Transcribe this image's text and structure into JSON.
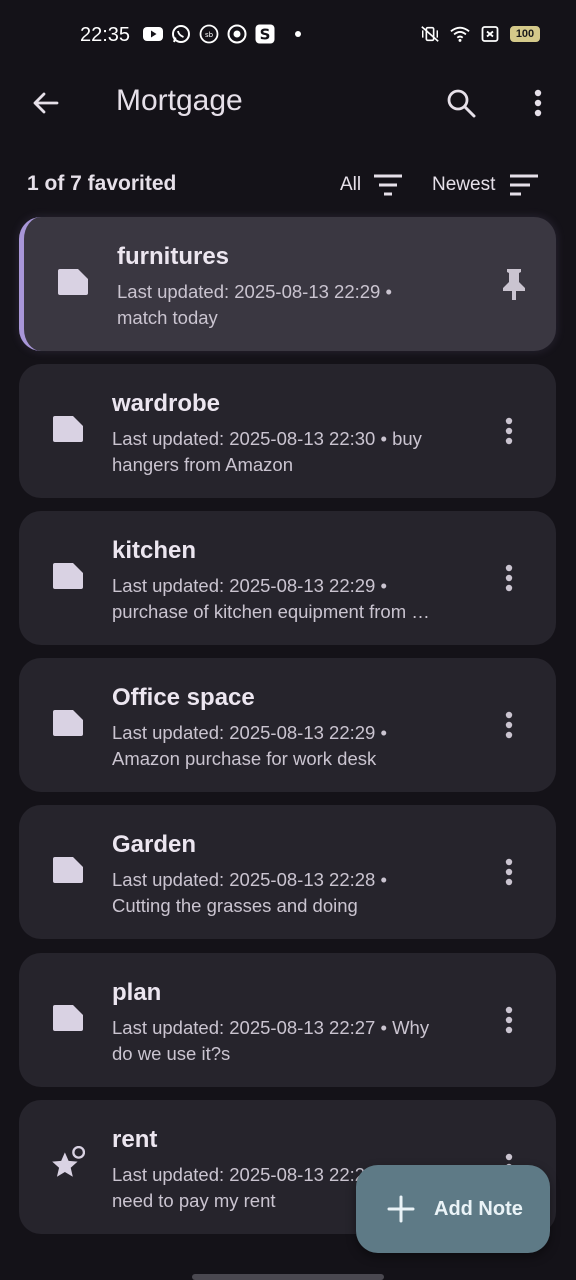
{
  "status_bar": {
    "time": "22:35",
    "left_icons": [
      "youtube-icon",
      "whatsapp-icon",
      "sb-app-icon",
      "chrome-icon",
      "s-app-icon"
    ],
    "right_icons": [
      "vibrate-icon",
      "wifi-icon",
      "sim-off-icon"
    ],
    "battery": "100",
    "battery_color": "#d4c98a"
  },
  "app_bar": {
    "title": "Mortgage"
  },
  "filters": {
    "favorited_text": "1 of 7 favorited",
    "filter_label": "All",
    "sort_label": "Newest"
  },
  "notes": [
    {
      "title": "furnitures",
      "line1": "Last updated: 2025-08-13 22:29 •",
      "line2": "match today",
      "pinned": true,
      "icon": "note-icon",
      "action": "pin-icon"
    },
    {
      "title": "wardrobe",
      "line1": "Last updated: 2025-08-13 22:30 • buy",
      "line2": "hangers from Amazon",
      "pinned": false,
      "icon": "note-icon",
      "action": "more-vert-icon"
    },
    {
      "title": "kitchen",
      "line1": "Last updated: 2025-08-13 22:29 •",
      "line2": "purchase of kitchen equipment from …",
      "pinned": false,
      "icon": "note-icon",
      "action": "more-vert-icon"
    },
    {
      "title": "Office space",
      "line1": "Last updated: 2025-08-13 22:29 •",
      "line2": "Amazon purchase for work desk",
      "pinned": false,
      "icon": "note-icon",
      "action": "more-vert-icon"
    },
    {
      "title": "Garden",
      "line1": "Last updated: 2025-08-13 22:28 •",
      "line2": "Cutting the grasses and doing",
      "pinned": false,
      "icon": "note-icon",
      "action": "more-vert-icon"
    },
    {
      "title": "plan",
      "line1": "Last updated: 2025-08-13 22:27 • Why",
      "line2": "do we use it?s",
      "pinned": false,
      "icon": "note-icon",
      "action": "more-vert-icon"
    },
    {
      "title": "rent",
      "line1": "Last updated: 2025-08-13 22:2",
      "line2": "need to pay my rent",
      "pinned": false,
      "icon": "star-icon",
      "action": "more-vert-icon"
    }
  ],
  "fab": {
    "label": "Add Note",
    "color": "#5E7A86"
  },
  "colors": {
    "background": "#141218",
    "card": "#26242C",
    "pinned_card": "#3A3741",
    "pinned_accent": "#A896D8"
  }
}
